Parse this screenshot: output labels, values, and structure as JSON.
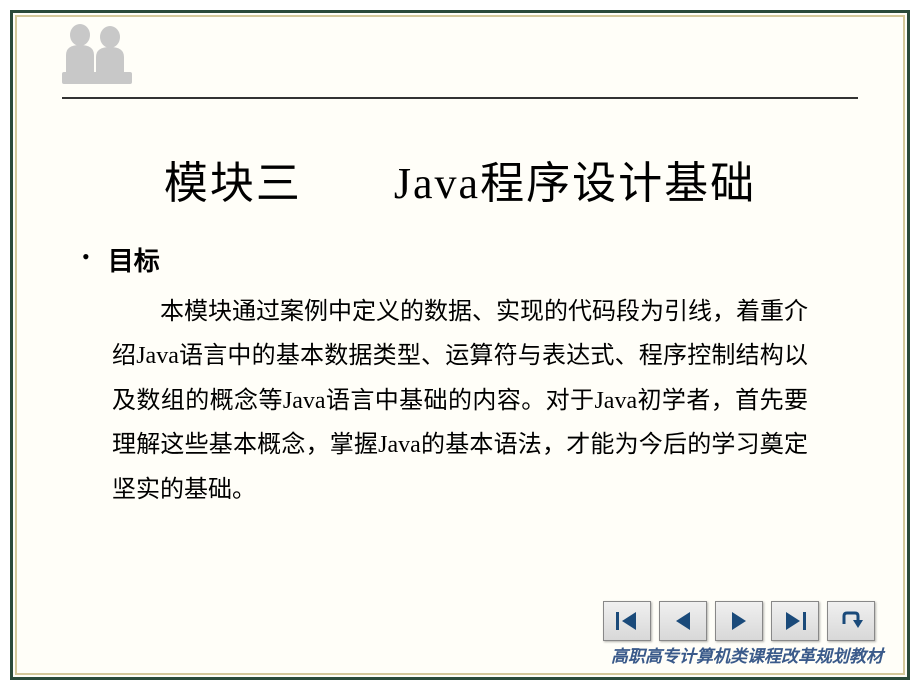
{
  "slide": {
    "title": "模块三　　Java程序设计基础",
    "subtitle_label": "目标",
    "body": "本模块通过案例中定义的数据、实现的代码段为引线，着重介绍Java语言中的基本数据类型、运算符与表达式、程序控制结构以及数组的概念等Java语言中基础的内容。对于Java初学者，首先要理解这些基本概念，掌握Java的基本语法，才能为今后的学习奠定坚实的基础。"
  },
  "footer": {
    "text": "高职高专计算机类课程改革规划教材"
  },
  "nav": {
    "first": "first",
    "prev": "prev",
    "next": "next",
    "last": "last",
    "return": "return"
  }
}
